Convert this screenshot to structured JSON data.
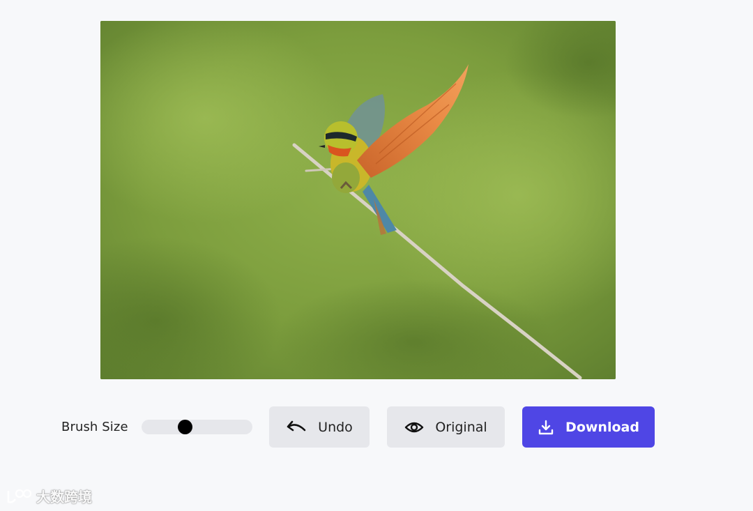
{
  "toolbar": {
    "brush_size_label": "Brush Size",
    "brush_size_value": 0.38,
    "undo_label": "Undo",
    "original_label": "Original",
    "download_label": "Download"
  },
  "icons": {
    "undo": "undo-icon",
    "original": "eye-icon",
    "download": "download-icon"
  },
  "colors": {
    "page_background": "#f7f8fa",
    "secondary_button": "#e6e7eb",
    "primary_button": "#4f46e5",
    "slider_thumb": "#000000"
  },
  "watermark": {
    "text": "大数跨境"
  }
}
